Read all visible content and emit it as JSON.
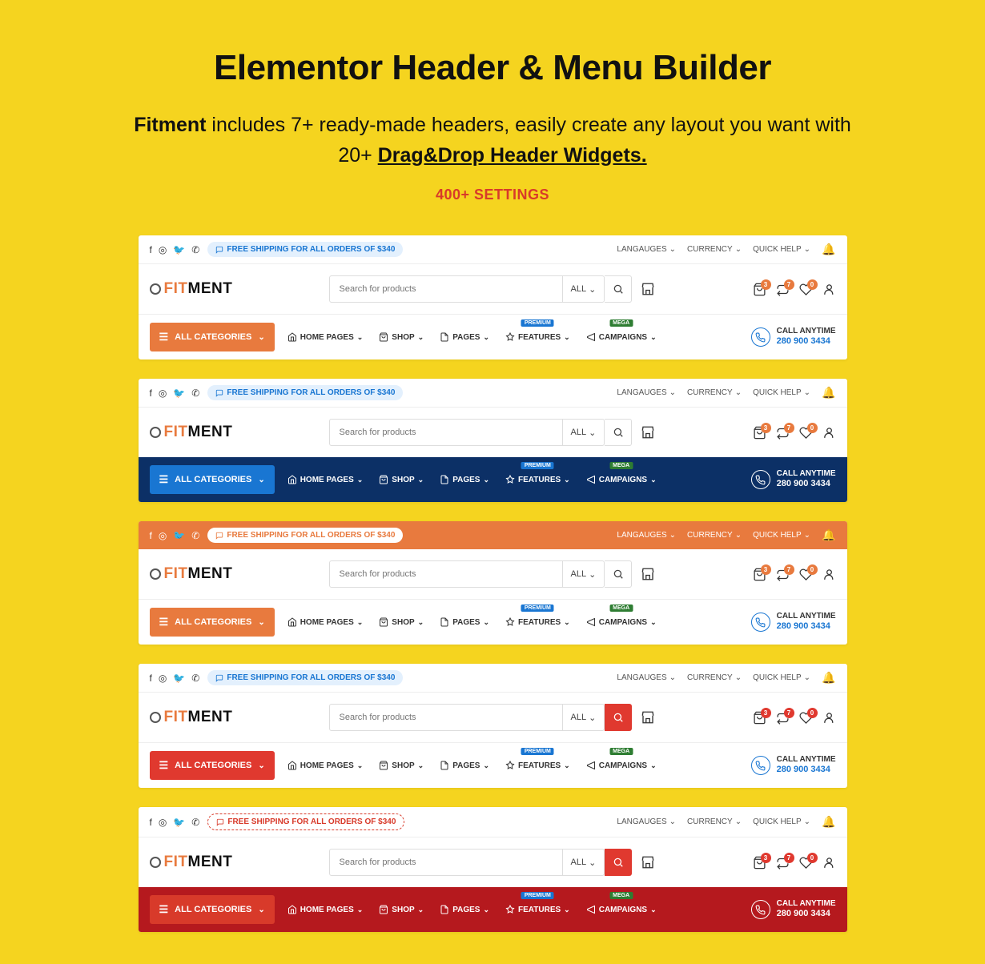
{
  "hero": {
    "title": "Elementor Header & Menu Builder",
    "brand": "Fitment",
    "desc1": " includes 7+ ready-made headers, easily create any layout you want with 20+ ",
    "desc2": "Drag&Drop Header Widgets.",
    "settings": "400+ SETTINGS"
  },
  "common": {
    "promo": "FREE SHIPPING FOR ALL ORDERS OF $340",
    "lang": "LANGAUGES",
    "curr": "CURRENCY",
    "help": "QUICK HELP",
    "logo_fit": "FIT",
    "logo_ment": "MENT",
    "search_ph": "Search for products",
    "all": "ALL",
    "cat": "ALL CATEGORIES",
    "badge3": "3",
    "badge7": "7",
    "badge0": "0",
    "call_l1": "CALL ANYTIME",
    "call_l2": "280 900 3434",
    "menu": {
      "home": "HOME PAGES",
      "shop": "SHOP",
      "pages": "PAGES",
      "features": "FEATURES",
      "camp": "CAMPAIGNS",
      "prem": "PREMIUM",
      "mega": "MEGA"
    }
  }
}
